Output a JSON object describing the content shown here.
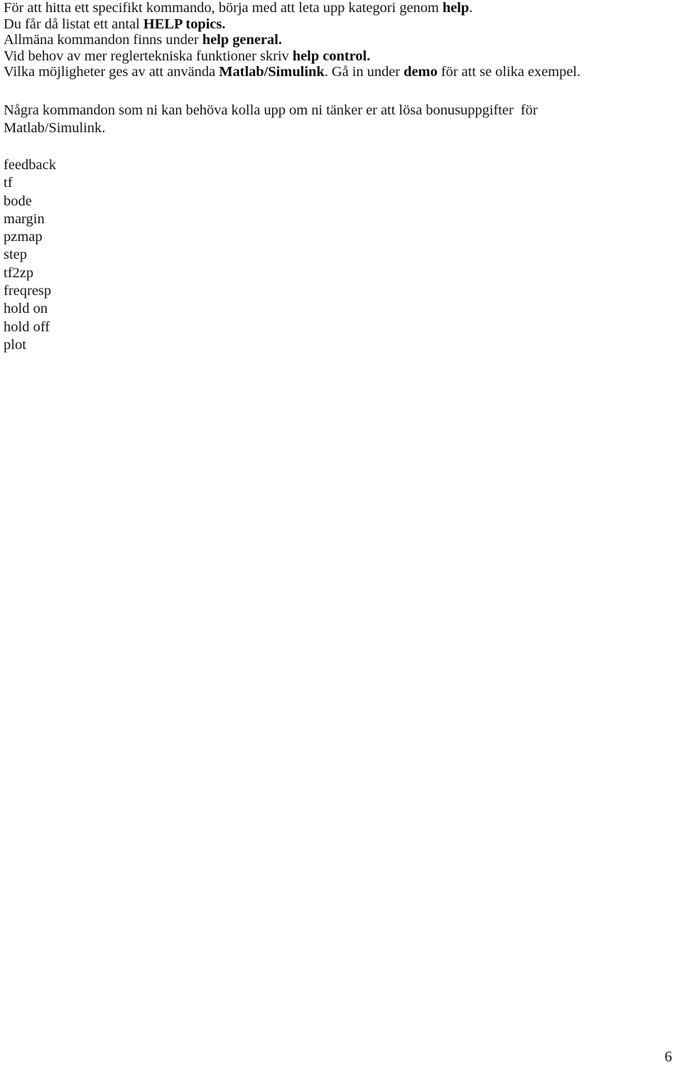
{
  "document": {
    "page_number": "6",
    "language": "sv",
    "intro": {
      "lines": [
        {
          "segments": [
            {
              "text": "För att hitta ett specifikt kommando, börja med att leta upp kategori genom ",
              "bold": false
            },
            {
              "text": "help",
              "bold": true
            },
            {
              "text": ".",
              "bold": false
            }
          ]
        },
        {
          "segments": [
            {
              "text": "Du får då listat ett antal ",
              "bold": false
            },
            {
              "text": "HELP topics.",
              "bold": true
            }
          ]
        },
        {
          "segments": [
            {
              "text": "Allmäna kommandon finns under ",
              "bold": false
            },
            {
              "text": "help general.",
              "bold": true
            }
          ]
        },
        {
          "segments": [
            {
              "text": "Vid behov av mer reglertekniska funktioner skriv ",
              "bold": false
            },
            {
              "text": "help control.",
              "bold": true
            }
          ]
        },
        {
          "segments": [
            {
              "text": "Vilka möjligheter ges av att använda ",
              "bold": false
            },
            {
              "text": "Matlab/Simulink",
              "bold": true
            },
            {
              "text": ". Gå in under ",
              "bold": false
            },
            {
              "text": "demo",
              "bold": true
            },
            {
              "text": " för att se olika exempel.",
              "bold": false
            }
          ]
        }
      ]
    },
    "note": {
      "lines": [
        {
          "segments": [
            {
              "text": "Några kommandon som ni kan behöva kolla upp om ni tänker er att lösa bonusuppgifter  för",
              "bold": false
            }
          ]
        },
        {
          "segments": [
            {
              "text": "Matlab/Simulink.",
              "bold": false
            }
          ]
        }
      ]
    },
    "commands": [
      "feedback",
      "tf",
      "bode",
      "margin",
      "pzmap",
      "step",
      "tf2zp",
      "freqresp",
      "hold on",
      "hold off",
      "plot"
    ]
  }
}
